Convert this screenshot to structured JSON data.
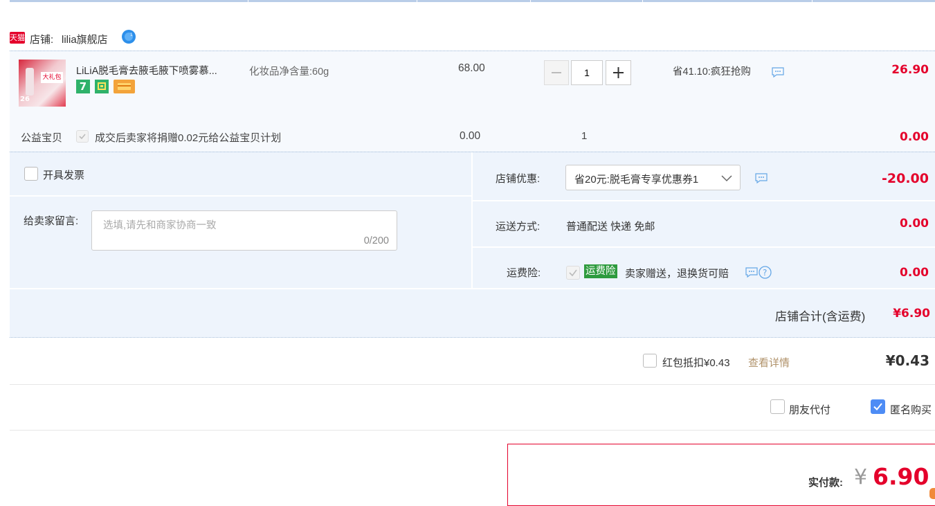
{
  "shop": {
    "tmall_badge": "天猫",
    "label": "店铺:",
    "name": "lilia旗舰店",
    "chat_icon": "wangwang-icon"
  },
  "item": {
    "title": "LiLiA脱毛膏去腋毛腋下喷雾慕...",
    "spec": "化妆品净含量:60g",
    "price": "68.00",
    "quantity": "1",
    "promo": "省41.10:疯狂抢购",
    "subtotal": "26.90",
    "thumb_text": "大礼包",
    "thumb_price": "26"
  },
  "charity": {
    "label": "公益宝贝",
    "text": "成交后卖家将捐赠0.02元给公益宝贝计划",
    "price": "0.00",
    "qty": "1",
    "subtotal": "0.00"
  },
  "invoice": {
    "label": "开具发票",
    "checked": false
  },
  "message": {
    "label": "给卖家留言:",
    "placeholder": "选填,请先和商家协商一致",
    "count": "0/200"
  },
  "discount": {
    "label": "店铺优惠:",
    "selected": "省20元:脱毛膏专享优惠券1",
    "amount": "-20.00"
  },
  "shipping": {
    "label": "运送方式:",
    "value": "普通配送 快递 免邮",
    "amount": "0.00"
  },
  "insurance": {
    "label": "运费险:",
    "tag": "运费险",
    "text": "卖家赠送，退换货可赔",
    "amount": "0.00"
  },
  "shop_total": {
    "label": "店铺合计(含运费)",
    "value": "¥6.90"
  },
  "redpacket": {
    "label": "红包抵扣¥0.43",
    "link": "查看详情",
    "amount": "¥0.43",
    "checked": false
  },
  "options": {
    "friend_pay": "朋友代付",
    "friend_checked": false,
    "anonymous": "匿名购买",
    "anonymous_checked": true
  },
  "payment": {
    "label": "实付款:",
    "currency": "¥",
    "amount": "6.90"
  },
  "colors": {
    "price_red": "#e4002b",
    "panel_bg": "#eef4fc",
    "accent_blue": "#4d8cf5",
    "insurance_green": "#2e9b3e",
    "tmall_red": "#e4002b"
  }
}
